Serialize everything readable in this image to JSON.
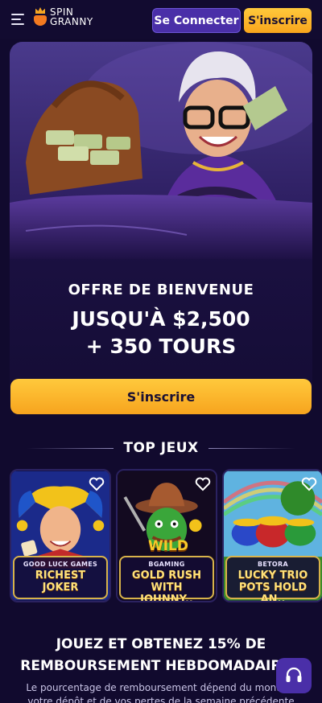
{
  "header": {
    "menu_icon": "hamburger-menu-icon",
    "logo_line1": "SPIN",
    "logo_line2": "GRANNY",
    "login_label": "Se Connecter",
    "register_label": "S'inscrire"
  },
  "hero": {
    "title": "OFFRE DE BIENVENUE",
    "amount_line1": "JUSQU'À $2,500",
    "amount_line2": "+ 350 TOURS",
    "cta_label": "S'inscrire"
  },
  "top_games": {
    "title": "TOP JEUX",
    "games": [
      {
        "provider": "GOOD LUCK GAMES",
        "name": "RICHEST JOKER"
      },
      {
        "provider": "BGAMING",
        "name": "GOLD RUSH\nWITH JOHNNY.."
      },
      {
        "provider": "BETORA",
        "name": "LUCKY TRIO\nPOTS HOLD AN.."
      }
    ],
    "badge_wild": "WILD"
  },
  "promo": {
    "title_line1": "JOUEZ ET OBTENEZ 15% DE",
    "title_line2": "REMBOURSEMENT HEBDOMADAIRE !",
    "desc_line1": "Le pourcentage de remboursement dépend du montant",
    "desc_line2": "votre dépôt et de vos pertes de la semaine précédente"
  },
  "colors": {
    "background": "#110a2e",
    "accent_yellow": "#ffc93c",
    "accent_purple": "#4a2fa8"
  },
  "icons": {
    "favorite": "heart-icon",
    "support": "headset-icon"
  }
}
